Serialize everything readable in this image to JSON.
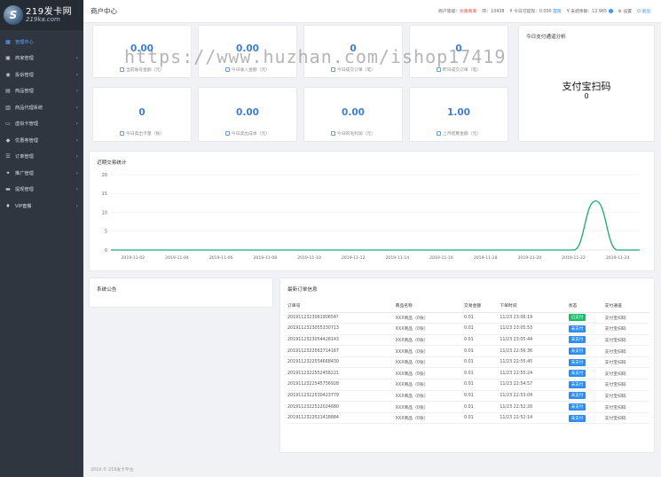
{
  "brand": {
    "title": "219发卡网",
    "sub": "219ka.com"
  },
  "sidebar": {
    "items": [
      {
        "label": "管理中心",
        "icon": "dashboard-icon",
        "active": true,
        "chevron": false
      },
      {
        "label": "商家管理",
        "icon": "store-icon",
        "chevron": true
      },
      {
        "label": "投诉管理",
        "icon": "complaint-icon",
        "chevron": true
      },
      {
        "label": "商品管理",
        "icon": "goods-icon",
        "chevron": true
      },
      {
        "label": "商品代理系统",
        "icon": "agent-icon",
        "chevron": true
      },
      {
        "label": "虚拟卡管理",
        "icon": "card-icon",
        "chevron": true
      },
      {
        "label": "优惠券管理",
        "icon": "coupon-icon",
        "chevron": true
      },
      {
        "label": "订单管理",
        "icon": "order-icon",
        "chevron": true
      },
      {
        "label": "推广管理",
        "icon": "promote-icon",
        "chevron": true
      },
      {
        "label": "提现管理",
        "icon": "withdraw-icon",
        "chevron": true
      },
      {
        "label": "VIP套餐",
        "icon": "vip-icon",
        "chevron": true
      }
    ]
  },
  "header": {
    "title": "商户中心",
    "level_label": "商户等级：",
    "level_value": "优质商家",
    "id_label": "ID：",
    "id_value": "10438",
    "withdraw_label": "今日可提现：",
    "withdraw_value": "0.000",
    "withdraw_link": "提现",
    "fee_label": "未结余额：",
    "fee_value": "12.965",
    "settings": "设置",
    "logout": "退出"
  },
  "stats_row1": [
    {
      "value": "0.00",
      "label": "当前账号金额（元）"
    },
    {
      "value": "0.00",
      "label": "今日收入金额（元）"
    },
    {
      "value": "0",
      "label": "今日成交订单（笔）"
    },
    {
      "value": "0",
      "label": "昨日成交订单（笔）"
    }
  ],
  "stats_row2": [
    {
      "value": "0",
      "label": "今日卖出卡量（张）"
    },
    {
      "value": "0.00",
      "label": "今日卖出成本（元）"
    },
    {
      "value": "0.00",
      "label": "今日的毛利润（元）"
    },
    {
      "value": "1.00",
      "label": "上月结算金额（元）"
    }
  ],
  "pay_panel": {
    "title": "今日支付通道分析",
    "channel": "支付宝扫码",
    "value": "0"
  },
  "watermark": "https://www.huzhan.com/ishop17419",
  "chart_panel": {
    "title": "近期交易统计"
  },
  "chart_data": {
    "type": "line",
    "x": [
      "2019-11-01",
      "2019-11-02",
      "2019-11-03",
      "2019-11-04",
      "2019-11-05",
      "2019-11-06",
      "2019-11-07",
      "2019-11-08",
      "2019-11-09",
      "2019-11-10",
      "2019-11-11",
      "2019-11-12",
      "2019-11-13",
      "2019-11-14",
      "2019-11-15",
      "2019-11-16",
      "2019-11-17",
      "2019-11-18",
      "2019-11-19",
      "2019-11-20",
      "2019-11-21",
      "2019-11-22",
      "2019-11-23",
      "2019-11-24",
      "2019-11-25"
    ],
    "tick_labels": [
      "2019-11-02",
      "2019-11-04",
      "2019-11-06",
      "2019-11-08",
      "2019-11-10",
      "2019-11-12",
      "2019-11-14",
      "2019-11-16",
      "2019-11-18",
      "2019-11-20",
      "2019-11-22",
      "2019-11-24"
    ],
    "series": [
      {
        "color": "#19aa70",
        "values": [
          0,
          0,
          0,
          0,
          0,
          0,
          0,
          0,
          0,
          0,
          0,
          0,
          0,
          0,
          0,
          0,
          0,
          0,
          0,
          0,
          0,
          0,
          13,
          0,
          0
        ]
      }
    ],
    "ylim": [
      0,
      20
    ],
    "yticks": [
      "0",
      "5",
      "10",
      "15",
      "20"
    ],
    "grid": true
  },
  "notice_panel": {
    "title": "系统公告"
  },
  "orders_panel": {
    "title": "最新订单信息",
    "headers": [
      "订单号",
      "商品名称",
      "交易金额",
      "下单时间",
      "状态",
      "支付通道"
    ],
    "rows": [
      [
        "201911232306190654?",
        "XXX商品（0张）",
        "0.01",
        "11/23 23:06:19",
        "已支付",
        "支付宝扫码"
      ],
      [
        "2019112323055330713",
        "XXX商品（0张）",
        "0.01",
        "11/23 23:05:53",
        "未支付",
        "支付宝扫码"
      ],
      [
        "2019112323054428143",
        "XXX商品（0张）",
        "0.01",
        "11/23 23:05:44",
        "未支付",
        "支付宝扫码"
      ],
      [
        "2019112322563714167",
        "XXX商品（0张）",
        "0.01",
        "11/23 22:56:36",
        "未支付",
        "支付宝扫码"
      ],
      [
        "2019112322554668430",
        "XXX商品（0张）",
        "0.01",
        "11/23 22:55:45",
        "未支付",
        "支付宝扫码"
      ],
      [
        "2019112322552458221",
        "XXX商品（0张）",
        "0.01",
        "11/23 22:55:24",
        "未支付",
        "支付宝扫码"
      ],
      [
        "2019112322545756928",
        "XXX商品（0张）",
        "0.01",
        "11/23 22:54:57",
        "未支付",
        "支付宝扫码"
      ],
      [
        "2019112322530423779",
        "XXX商品（0张）",
        "0.01",
        "11/23 22:53:04",
        "未支付",
        "支付宝扫码"
      ],
      [
        "2019112322522024680",
        "XXX商品（0张）",
        "0.01",
        "11/23 22:52:20",
        "未支付",
        "支付宝扫码"
      ],
      [
        "2019112322521418884",
        "XXX商品（0张）",
        "0.01",
        "11/23 22:52:14",
        "未支付",
        "支付宝扫码"
      ]
    ]
  },
  "footer": {
    "text": "2019 © 219发卡平台"
  },
  "colors": {
    "accent": "#3f7fd0",
    "paid": "#19be6b",
    "unpaid": "#2d8cf0",
    "sidebar": "#2f3640"
  }
}
